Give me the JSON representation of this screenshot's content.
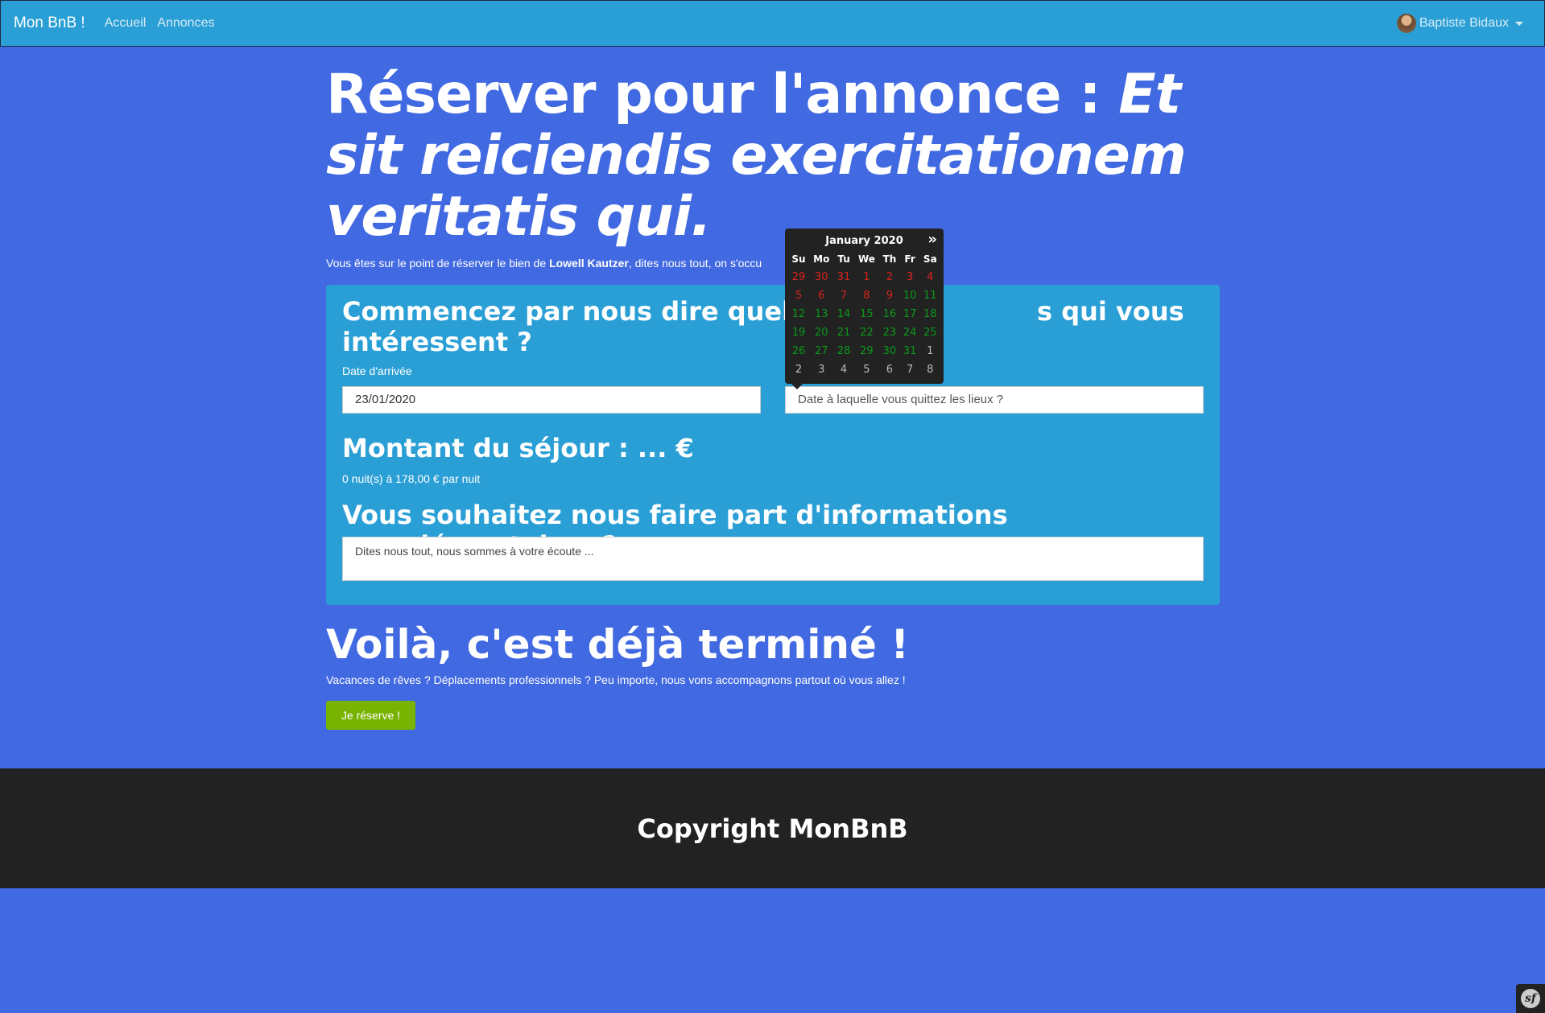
{
  "navbar": {
    "brand": "Mon BnB !",
    "links": [
      "Accueil",
      "Annonces"
    ],
    "user": "Baptiste Bidaux"
  },
  "page": {
    "title_plain": "Réserver pour l'annonce : ",
    "title_emphasis": "Et sit reiciendis exercitationem veritatis qui.",
    "intro_before": "Vous êtes sur le point de réserver le bien de ",
    "intro_owner": "Lowell Kautzer",
    "intro_after": ", dites nous tout, on s'occu"
  },
  "form": {
    "heading_part1": "Commencez par nous dire quelles s",
    "heading_part2": "s qui vous",
    "heading_line2": "intéressent ?",
    "arrival_label": "Date d'arrivée",
    "arrival_value": "23/01/2020",
    "departure_placeholder": "Date à laquelle vous quittez les lieux ?",
    "amount_heading": "Montant du séjour : ... €",
    "nights_text": "0 nuit(s) à 178,00 € par nuit",
    "comments_heading": "Vous souhaitez nous faire part d'informations complémentaires ?",
    "comments_placeholder": "Dites nous tout, nous sommes à votre écoute ..."
  },
  "finish": {
    "heading": "Voilà, c'est déjà terminé !",
    "text": "Vacances de rêves ? Déplacements professionnels ? Peu importe, nous vons accompagnons partout où vous allez !",
    "button": "Je réserve !"
  },
  "footer": {
    "text": "Copyright MonBnB"
  },
  "datepicker": {
    "month": "January 2020",
    "next": "»",
    "weekdays": [
      "Su",
      "Mo",
      "Tu",
      "We",
      "Th",
      "Fr",
      "Sa"
    ],
    "colors": {
      "unavailable": "#d9231c",
      "available": "#0a9a1a",
      "other_month": "#bbbbbb"
    },
    "weeks": [
      [
        [
          "29",
          "unavailable"
        ],
        [
          "30",
          "unavailable"
        ],
        [
          "31",
          "unavailable"
        ],
        [
          "1",
          "unavailable"
        ],
        [
          "2",
          "unavailable"
        ],
        [
          "3",
          "unavailable"
        ],
        [
          "4",
          "unavailable"
        ]
      ],
      [
        [
          "5",
          "unavailable"
        ],
        [
          "6",
          "unavailable"
        ],
        [
          "7",
          "unavailable"
        ],
        [
          "8",
          "unavailable"
        ],
        [
          "9",
          "unavailable"
        ],
        [
          "10",
          "available"
        ],
        [
          "11",
          "available"
        ]
      ],
      [
        [
          "12",
          "available"
        ],
        [
          "13",
          "available"
        ],
        [
          "14",
          "available"
        ],
        [
          "15",
          "available"
        ],
        [
          "16",
          "available"
        ],
        [
          "17",
          "available"
        ],
        [
          "18",
          "available"
        ]
      ],
      [
        [
          "19",
          "available"
        ],
        [
          "20",
          "available"
        ],
        [
          "21",
          "available"
        ],
        [
          "22",
          "available"
        ],
        [
          "23",
          "available"
        ],
        [
          "24",
          "available"
        ],
        [
          "25",
          "available"
        ]
      ],
      [
        [
          "26",
          "available"
        ],
        [
          "27",
          "available"
        ],
        [
          "28",
          "available"
        ],
        [
          "29",
          "available"
        ],
        [
          "30",
          "available"
        ],
        [
          "31",
          "available"
        ],
        [
          "1",
          "other_month"
        ]
      ],
      [
        [
          "2",
          "other_month"
        ],
        [
          "3",
          "other_month"
        ],
        [
          "4",
          "other_month"
        ],
        [
          "5",
          "other_month"
        ],
        [
          "6",
          "other_month"
        ],
        [
          "7",
          "other_month"
        ],
        [
          "8",
          "other_month"
        ]
      ]
    ]
  },
  "icons": {
    "avatar": "user-avatar",
    "caret": "chevron-down-icon",
    "symfony": "symfony-toolbar-icon"
  }
}
